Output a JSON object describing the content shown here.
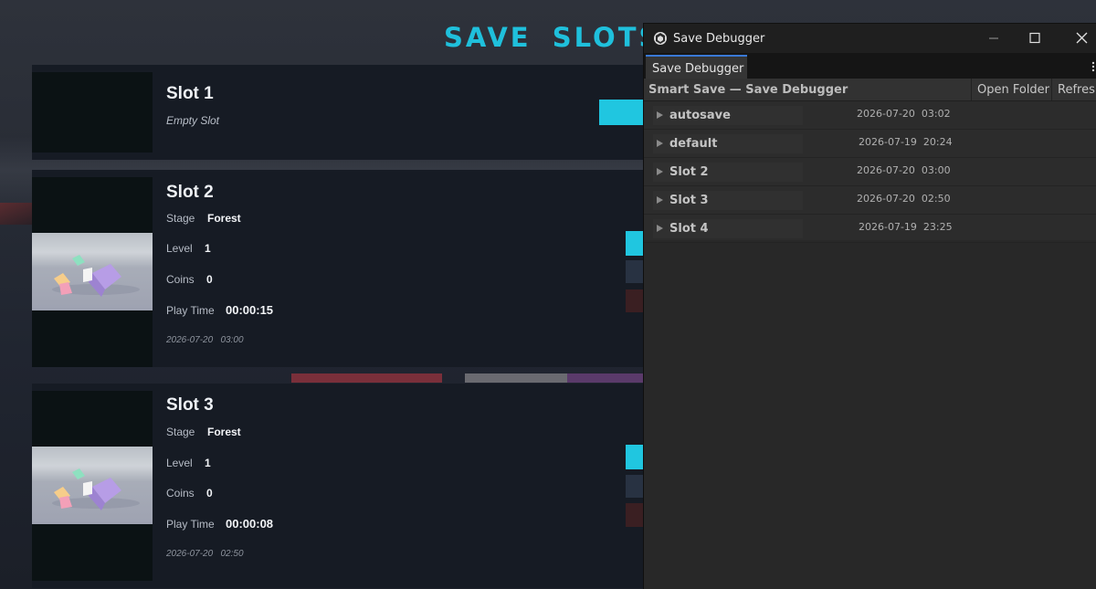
{
  "game": {
    "title": "SAVE  SLOTS",
    "slots": [
      {
        "name": "Slot 1",
        "empty_text": "Empty Slot"
      },
      {
        "name": "Slot 2",
        "stage_label": "Stage",
        "stage_value": "Forest",
        "level_label": "Level",
        "level_value": "1",
        "coins_label": "Coins",
        "coins_value": "0",
        "playtime_label": "Play Time",
        "playtime_value": "00:00:15",
        "date": "2026-07-20   03:00"
      },
      {
        "name": "Slot 3",
        "stage_label": "Stage",
        "stage_value": "Forest",
        "level_label": "Level",
        "level_value": "1",
        "coins_label": "Coins",
        "coins_value": "0",
        "playtime_label": "Play Time",
        "playtime_value": "00:00:08",
        "date": "2026-07-20   02:50"
      }
    ],
    "colors": {
      "accent": "#1fc0dc",
      "panel": "#161b24",
      "delete": "#3a1f22"
    }
  },
  "debugger": {
    "window_title": "Save Debugger",
    "tab_label": "Save Debugger",
    "heading": "Smart Save — Save Debugger",
    "open_folder_label": "Open Folder",
    "refresh_label": "Refresh",
    "entries": [
      {
        "name": "autosave",
        "date": "2026-07-20  03:02"
      },
      {
        "name": "default",
        "date": "2026-07-19  20:24"
      },
      {
        "name": "Slot 2",
        "date": "2026-07-20  03:00"
      },
      {
        "name": "Slot 3",
        "date": "2026-07-20  02:50"
      },
      {
        "name": "Slot 4",
        "date": "2026-07-19  23:25"
      }
    ],
    "icons": {
      "app": "unity-icon",
      "minimize": "minimize-icon",
      "maximize": "maximize-icon",
      "close": "close-icon",
      "more": "more-vertical-icon",
      "foldout": "triangle-right-icon"
    }
  }
}
